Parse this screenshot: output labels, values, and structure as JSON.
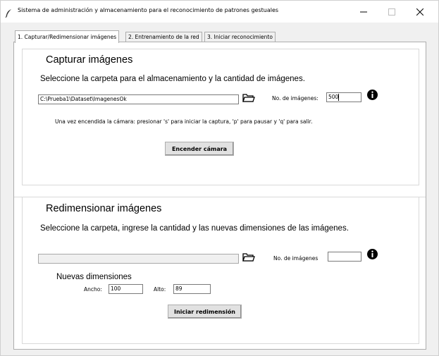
{
  "window": {
    "title": "Sistema de administración y almacenamiento para el reconocimiento de patrones gestuales",
    "controls": {
      "minimize": "—",
      "maximize": "☐",
      "close": "✕"
    }
  },
  "tabs": [
    {
      "label": "1. Capturar/Redimensionar imágenes",
      "active": true
    },
    {
      "label": "2. Entrenamiento de la red",
      "active": false
    },
    {
      "label": "3. Iniciar reconocimiento",
      "active": false
    }
  ],
  "capture": {
    "title": "Capturar imágenes",
    "instruction": "Seleccione la carpeta para el almacenamiento y la cantidad de imágenes.",
    "folder_value": "C:\\Prueba1\\Dataset\\ImagenesOk",
    "count_label": "No. de imágenes:",
    "count_value": "500",
    "camera_help": "Una vez encendida la cámara: presionar 's' para iniciar la captura, 'p' para pausar y 'q' para salir.",
    "start_button": "Encender cámara"
  },
  "resize": {
    "title": "Redimensionar imágenes",
    "instruction": "Seleccione la carpeta, ingrese la cantidad y las nuevas dimensiones de las imágenes.",
    "folder_value": "",
    "count_label": "No. de imágenes",
    "count_value": "",
    "dims_title": "Nuevas dimensiones",
    "width_label": "Ancho:",
    "width_value": "100",
    "height_label": "Alto:",
    "height_value": "89",
    "start_button": "Iniciar redimensión"
  },
  "icons": {
    "app": "feather-icon",
    "folder": "folder-open-icon",
    "info": "info-icon"
  }
}
